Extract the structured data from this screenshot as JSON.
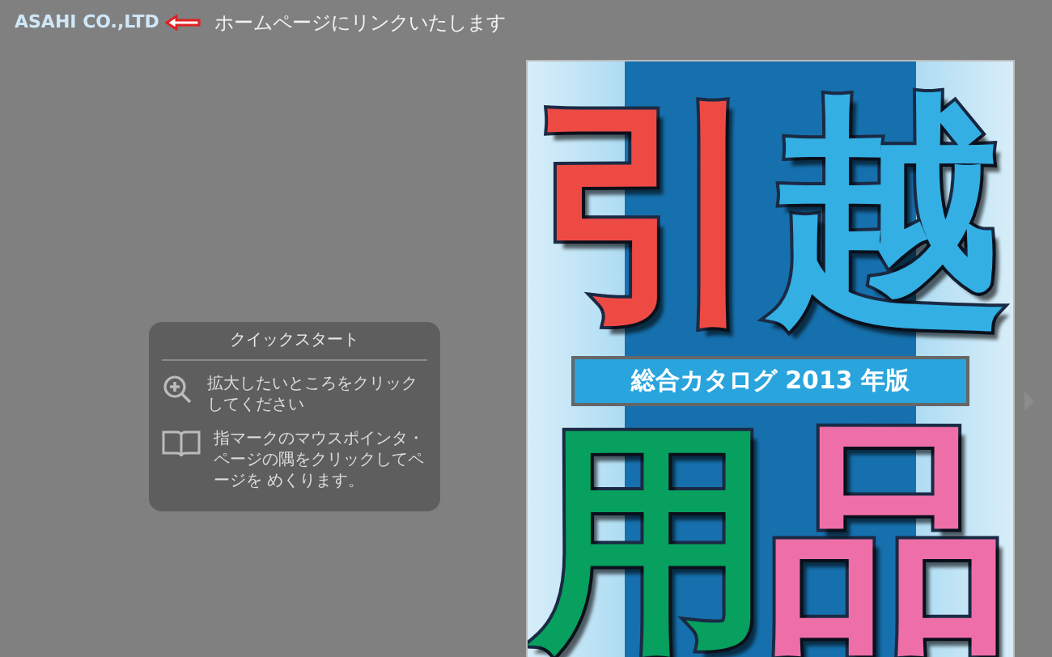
{
  "header": {
    "company_link": "ASAHI CO.,LTD",
    "note": "ホームページにリンクいたします"
  },
  "quick_start": {
    "title": "クイックスタート",
    "items": [
      {
        "kind": "zoom",
        "text": "拡大したいところをクリックしてください"
      },
      {
        "kind": "page",
        "text": "指マークのマウスポインタ・ページの隅をクリックしてページを めくります。"
      }
    ]
  },
  "cover": {
    "top": [
      {
        "char": "引",
        "color": "#ee4a44"
      },
      {
        "char": "越",
        "color": "#33afe4"
      }
    ],
    "subtitle": "総合カタログ 2013 年版",
    "bottom": [
      {
        "char": "用",
        "color": "#07a05e"
      },
      {
        "char": "品",
        "color": "#ee6fa8"
      }
    ]
  }
}
